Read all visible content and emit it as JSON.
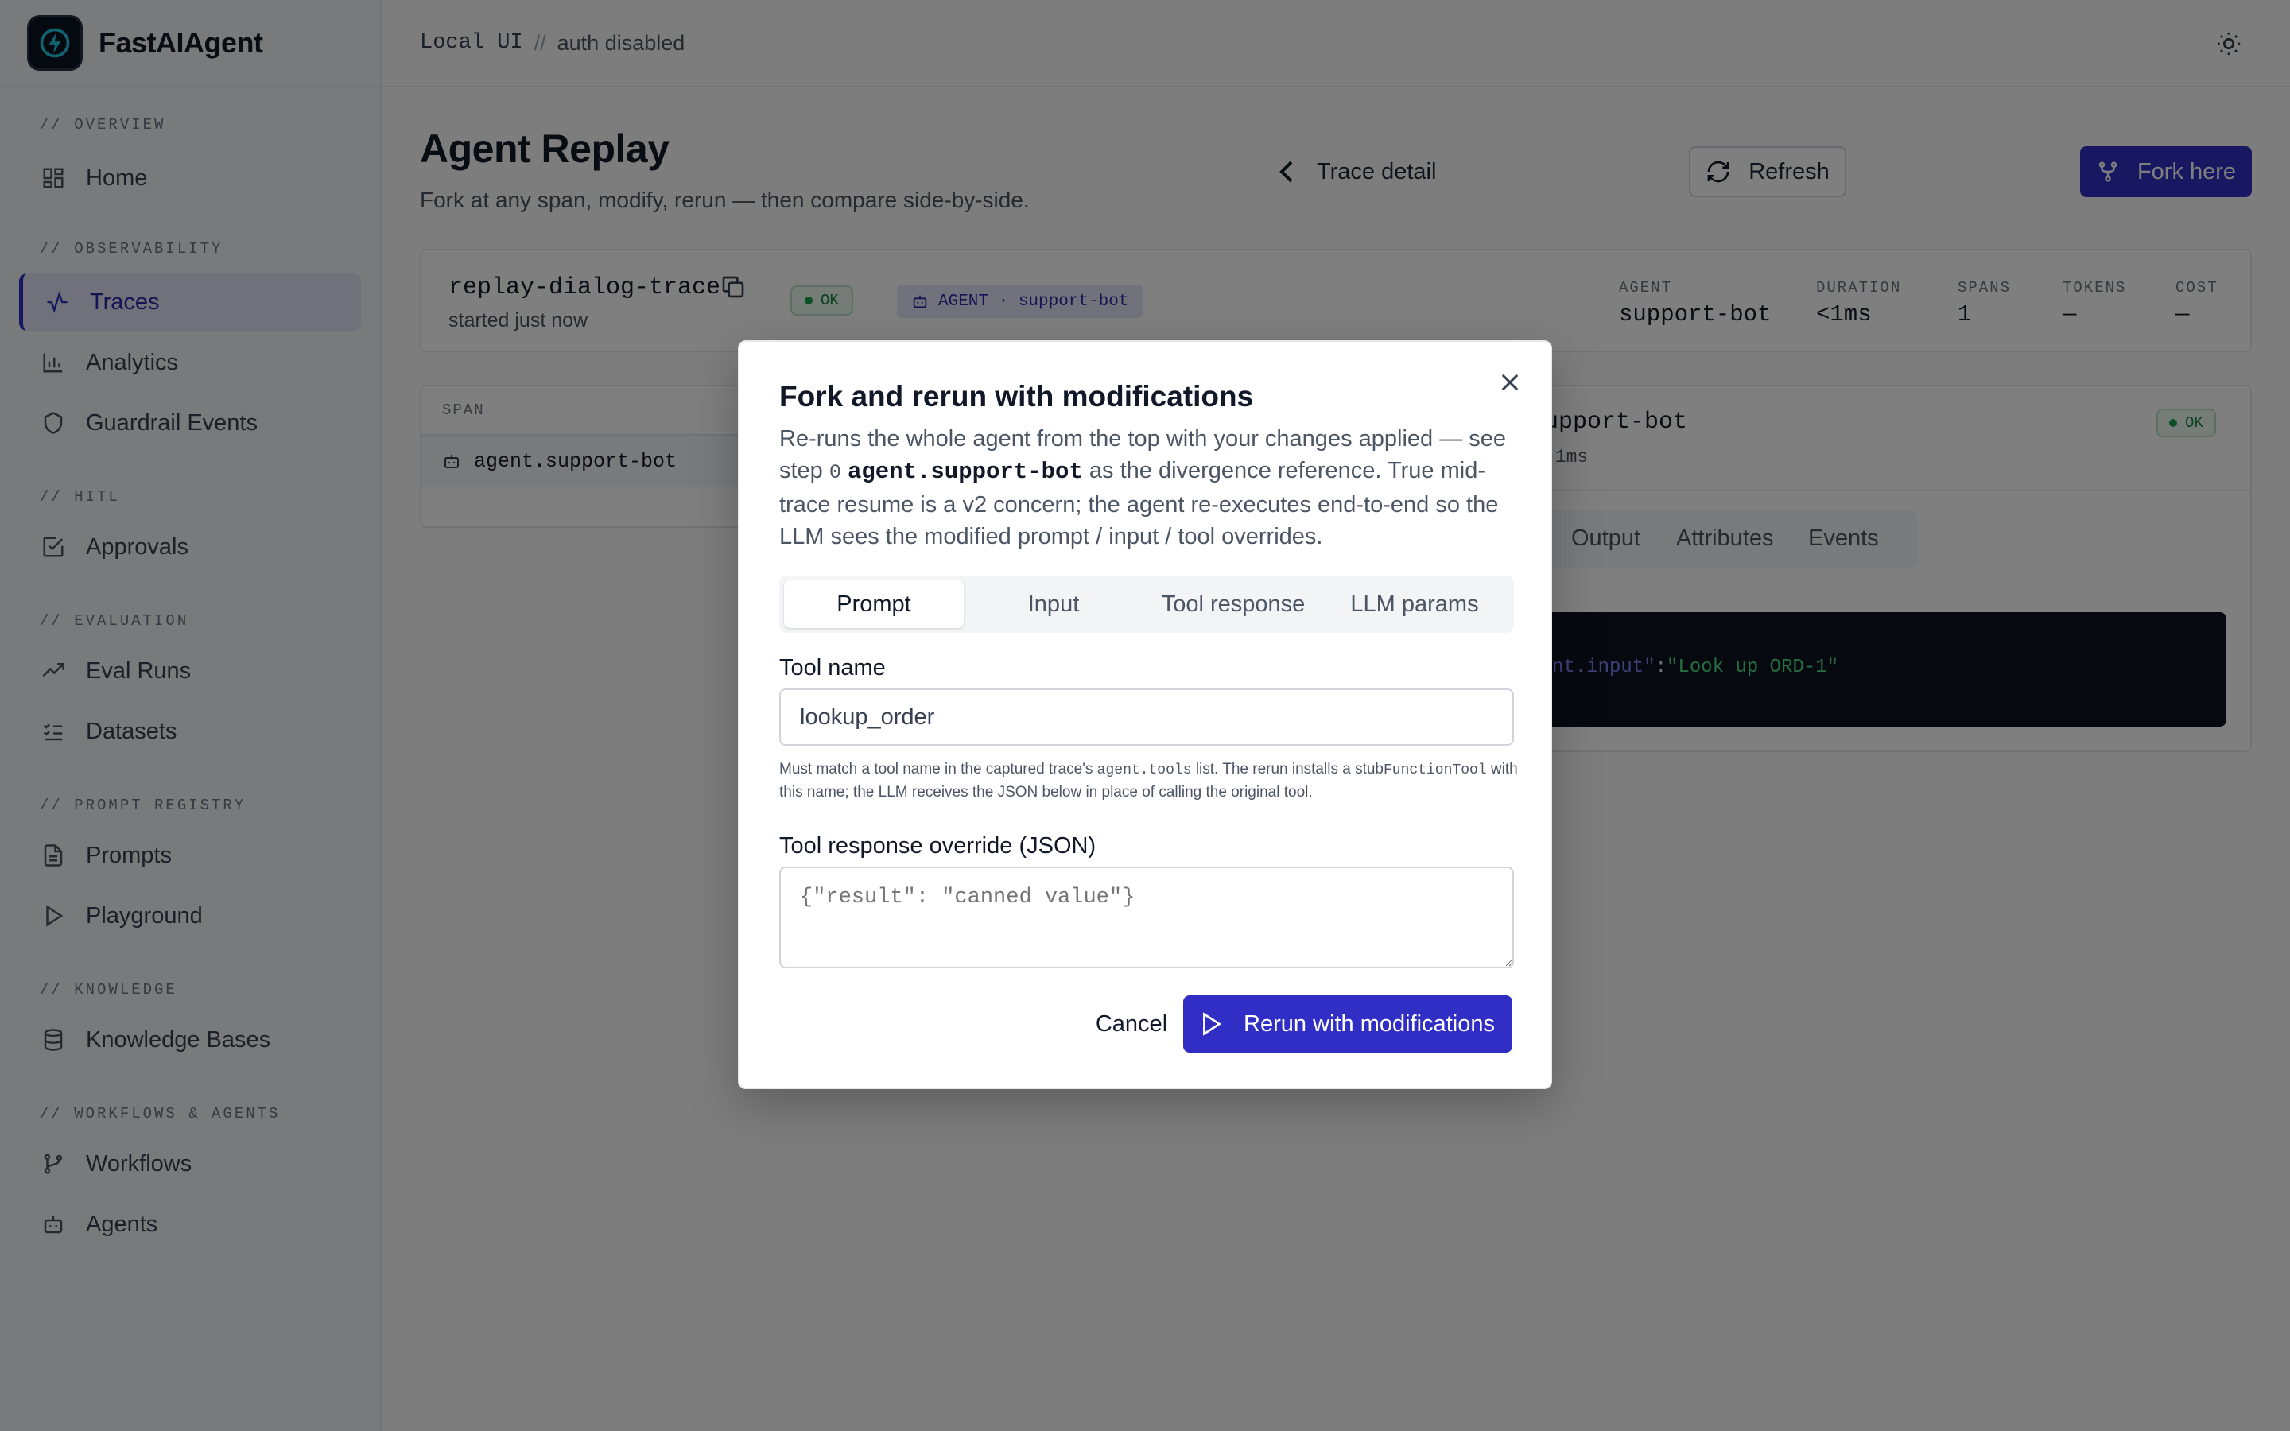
{
  "app": {
    "name": "FastAIAgent"
  },
  "topbar": {
    "local": "Local UI",
    "separator": "//",
    "auth": "auth disabled"
  },
  "sidebar": {
    "sections": [
      {
        "title": "// OVERVIEW",
        "items": [
          {
            "label": "Home",
            "icon": "grid-icon"
          }
        ]
      },
      {
        "title": "// OBSERVABILITY",
        "items": [
          {
            "label": "Traces",
            "icon": "activity-icon",
            "active": true
          },
          {
            "label": "Analytics",
            "icon": "bar-chart-icon"
          },
          {
            "label": "Guardrail Events",
            "icon": "shield-icon"
          }
        ]
      },
      {
        "title": "// HITL",
        "items": [
          {
            "label": "Approvals",
            "icon": "check-square-icon"
          }
        ]
      },
      {
        "title": "// EVALUATION",
        "items": [
          {
            "label": "Eval Runs",
            "icon": "trending-up-icon"
          },
          {
            "label": "Datasets",
            "icon": "list-checks-icon"
          }
        ]
      },
      {
        "title": "// PROMPT REGISTRY",
        "items": [
          {
            "label": "Prompts",
            "icon": "file-text-icon"
          },
          {
            "label": "Playground",
            "icon": "play-icon"
          }
        ]
      },
      {
        "title": "// KNOWLEDGE",
        "items": [
          {
            "label": "Knowledge Bases",
            "icon": "database-icon"
          }
        ]
      },
      {
        "title": "// WORKFLOWS & AGENTS",
        "items": [
          {
            "label": "Workflows",
            "icon": "git-branch-icon"
          },
          {
            "label": "Agents",
            "icon": "bot-icon"
          }
        ]
      }
    ]
  },
  "page": {
    "title": "Agent Replay",
    "subtitle": "Fork at any span, modify, rerun — then compare side-by-side.",
    "trace_detail": "Trace detail",
    "refresh": "Refresh",
    "fork_here": "Fork here"
  },
  "trace": {
    "name": "replay-dialog-trace",
    "started": "started just now",
    "status": "OK",
    "agent_badge": "AGENT · support-bot",
    "stats": [
      {
        "label": "AGENT",
        "value": "support-bot"
      },
      {
        "label": "DURATION",
        "value": "<1ms"
      },
      {
        "label": "SPANS",
        "value": "1"
      },
      {
        "label": "TOKENS",
        "value": "—"
      },
      {
        "label": "COST",
        "value": "—"
      }
    ]
  },
  "span_list": {
    "header": "SPAN",
    "rows": [
      "agent.support-bot"
    ]
  },
  "span_detail": {
    "title": "upport-bot",
    "subtitle": ":1ms",
    "status": "OK",
    "tabs": [
      "Output",
      "Attributes",
      "Events"
    ],
    "code_key": "nt.input\"",
    "code_colon": ":",
    "code_value": "\"Look up ORD-1\""
  },
  "modal": {
    "title": "Fork and rerun with modifications",
    "desc_1": "Re-runs the whole agent from the top with your changes applied — see step",
    "desc_step": "0",
    "desc_agent": "agent.support-bot",
    "desc_2": "as the divergence reference. True mid-trace resume is a v2 concern; the agent re-executes end-to-end so the LLM sees the modified prompt / input / tool overrides.",
    "tabs": [
      "Prompt",
      "Input",
      "Tool response",
      "LLM params"
    ],
    "active_tab": "Prompt",
    "tool_name_label": "Tool name",
    "tool_name_value": "lookup_order",
    "help_1": "Must match a tool name in the captured trace's",
    "help_code_1": "agent.tools",
    "help_2": "list. The rerun installs a stub",
    "help_code_2": "FunctionTool",
    "help_3": "with this name; the LLM receives the JSON below in place of calling the original tool.",
    "override_label": "Tool response override (JSON)",
    "override_placeholder": "{\"result\": \"canned value\"}",
    "cancel": "Cancel",
    "rerun": "Rerun with modifications"
  },
  "colors": {
    "accent": "#312ec5",
    "ok": "#16a34a",
    "overlay": "rgba(0,0,0,0.5)"
  }
}
